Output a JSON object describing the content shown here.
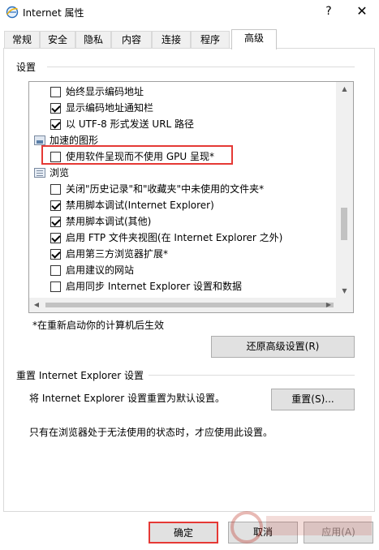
{
  "window": {
    "title": "Internet 属性",
    "help": "?",
    "close": "✕"
  },
  "tabs": [
    "常规",
    "安全",
    "隐私",
    "内容",
    "连接",
    "程序",
    "高级"
  ],
  "settings": {
    "group_label": "设置",
    "rows": [
      {
        "type": "checkbox",
        "checked": false,
        "label": "始终显示编码地址"
      },
      {
        "type": "checkbox",
        "checked": true,
        "label": "显示编码地址通知栏"
      },
      {
        "type": "checkbox",
        "checked": true,
        "label": "以 UTF-8 形式发送 URL 路径"
      },
      {
        "type": "category",
        "label": "加速的图形"
      },
      {
        "type": "checkbox",
        "checked": false,
        "label": "使用软件呈现而不使用 GPU 呈现*"
      },
      {
        "type": "category",
        "label": "浏览"
      },
      {
        "type": "checkbox",
        "checked": false,
        "label": "关闭\"历史记录\"和\"收藏夹\"中未使用的文件夹*"
      },
      {
        "type": "checkbox",
        "checked": true,
        "label": "禁用脚本调试(Internet Explorer)"
      },
      {
        "type": "checkbox",
        "checked": true,
        "label": "禁用脚本调试(其他)"
      },
      {
        "type": "checkbox",
        "checked": true,
        "label": "启用 FTP 文件夹视图(在 Internet Explorer 之外)"
      },
      {
        "type": "checkbox",
        "checked": true,
        "label": "启用第三方浏览器扩展*"
      },
      {
        "type": "checkbox",
        "checked": false,
        "label": "启用建议的网站"
      },
      {
        "type": "checkbox",
        "checked": false,
        "label": "启用同步 Internet Explorer 设置和数据"
      }
    ],
    "restart_note": "*在重新启动你的计算机后生效",
    "restore_button": "还原高级设置(R)"
  },
  "reset": {
    "group_label": "重置 Internet Explorer 设置",
    "description": "将 Internet Explorer 设置重置为默认设置。",
    "button": "重置(S)...",
    "warning": "只有在浏览器处于无法使用的状态时，才应使用此设置。"
  },
  "footer": {
    "ok": "确定",
    "cancel": "取消",
    "apply": "应用(A)"
  },
  "colors": {
    "highlight": "#e53935"
  }
}
